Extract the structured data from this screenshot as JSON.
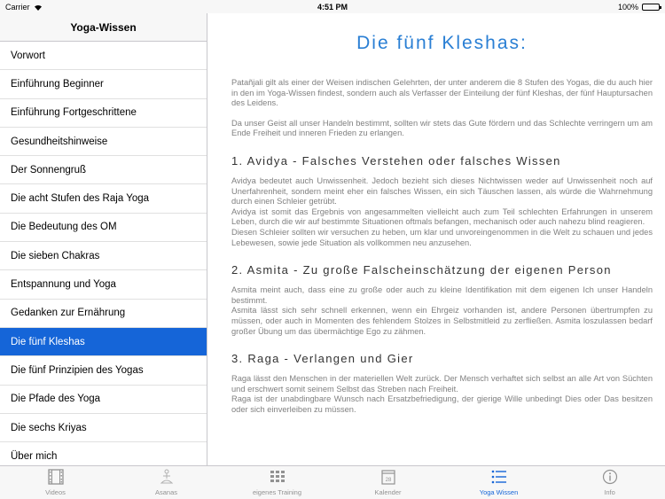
{
  "statusbar": {
    "carrier": "Carrier",
    "time": "4:51 PM",
    "battery": "100%"
  },
  "sidebar": {
    "title": "Yoga-Wissen",
    "items": [
      {
        "label": "Vorwort"
      },
      {
        "label": "Einführung Beginner"
      },
      {
        "label": "Einführung Fortgeschrittene"
      },
      {
        "label": "Gesundheitshinweise"
      },
      {
        "label": "Der Sonnengruß"
      },
      {
        "label": "Die acht Stufen des Raja Yoga"
      },
      {
        "label": "Die Bedeutung des OM"
      },
      {
        "label": "Die sieben Chakras"
      },
      {
        "label": "Entspannung und Yoga"
      },
      {
        "label": "Gedanken zur Ernährung"
      },
      {
        "label": "Die fünf Kleshas",
        "active": true
      },
      {
        "label": "Die fünf Prinzipien des Yogas"
      },
      {
        "label": "Die Pfade des Yoga"
      },
      {
        "label": "Die sechs Kriyas"
      },
      {
        "label": "Über mich"
      }
    ]
  },
  "content": {
    "title": "Die fünf Kleshas:",
    "intro1": "Patañjali gilt als einer der Weisen indischen Gelehrten, der unter anderem die 8 Stufen des Yogas, die du auch hier in den im Yoga-Wissen findest, sondern auch als Verfasser der Einteilung der fünf Kleshas, der fünf Hauptursachen des Leidens.",
    "intro2": "Da unser Geist all unser Handeln bestimmt, sollten wir stets das Gute fördern und das Schlechte verringern um am Ende Freiheit und inneren Frieden zu erlangen.",
    "sections": [
      {
        "heading": "1. Avidya - Falsches Verstehen oder falsches Wissen",
        "p1": "Avidya bedeutet auch Unwissenheit. Jedoch bezieht sich dieses Nichtwissen weder auf Unwissenheit noch auf Unerfahrenheit, sondern meint eher ein falsches Wissen, ein sich Täuschen lassen, als würde die Wahrnehmung durch einen Schleier getrübt.",
        "p2": "Avidya ist somit das Ergebnis von angesammelten vielleicht auch zum Teil schlechten Erfahrungen in unserem Leben, durch die wir auf bestimmte Situationen oftmals befangen, mechanisch oder auch nahezu blind reagieren.",
        "p3": "Diesen Schleier sollten wir versuchen zu heben, um klar und unvoreingenommen in die Welt zu schauen und jedes Lebewesen, sowie jede Situation als vollkommen neu anzusehen."
      },
      {
        "heading": "2. Asmita - Zu große Falscheinschätzung der eigenen Person",
        "p1": "Asmita meint auch, dass eine zu große oder auch zu kleine Identifikation mit dem eigenen Ich unser Handeln bestimmt.",
        "p2": "Asmita lässt sich sehr schnell erkennen, wenn ein Ehrgeiz vorhanden ist, andere Personen übertrumpfen zu müssen, oder auch in Momenten des fehlendem Stolzes in Selbstmitleid zu zerfließen. Asmita loszulassen bedarf großer Übung um das übermächtige Ego zu zähmen."
      },
      {
        "heading": "3. Raga - Verlangen und Gier",
        "p1": "Raga lässt den Menschen in der materiellen Welt zurück. Der Mensch verhaftet sich selbst an alle Art von Süchten und erschwert somit seinem Selbst das Streben nach Freiheit.",
        "p2": "Raga ist der unabdingbare Wunsch nach Ersatzbefriedigung, der gierige Wille unbedingt Dies oder Das besitzen oder sich einverleiben zu müssen."
      }
    ]
  },
  "tabbar": {
    "tabs": [
      {
        "label": "Videos",
        "icon": "film-icon"
      },
      {
        "label": "Asanas",
        "icon": "yoga-pose-icon"
      },
      {
        "label": "eigenes Training",
        "icon": "grid-icon"
      },
      {
        "label": "Kalender",
        "icon": "calendar-icon",
        "day": "28"
      },
      {
        "label": "Yoga Wissen",
        "icon": "list-icon",
        "active": true
      },
      {
        "label": "Info",
        "icon": "info-icon"
      }
    ]
  },
  "colors": {
    "accent": "#1565d8",
    "title": "#2a7fd4",
    "body_text": "#808080",
    "inactive_tab": "#929292"
  }
}
